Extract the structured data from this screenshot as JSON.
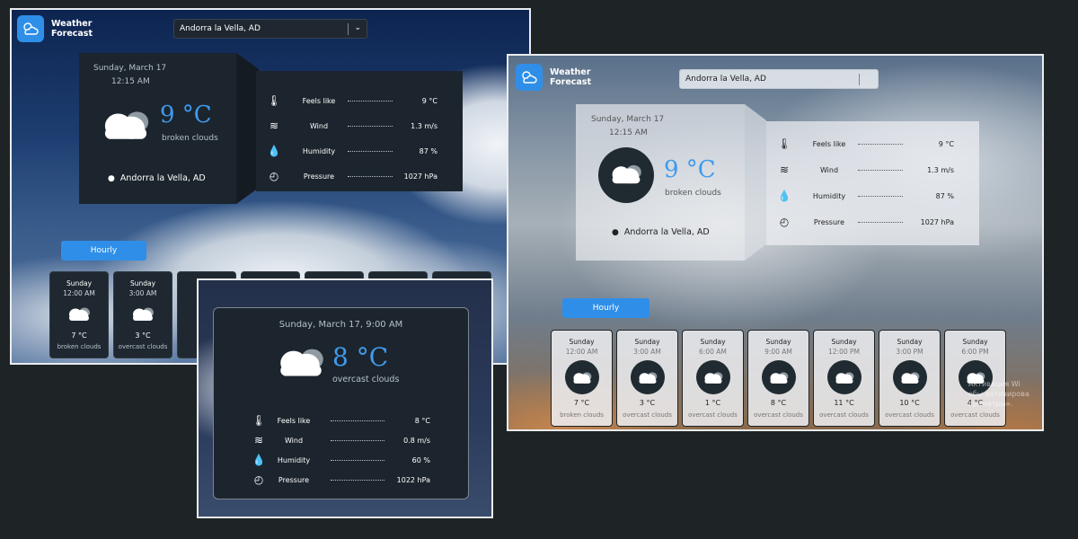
{
  "app": {
    "name_line1": "Weather",
    "name_line2": "Forecast"
  },
  "city_select": {
    "value": "Andorra la Vella, AD"
  },
  "current": {
    "date": "Sunday, March 17",
    "time": "12:15 AM",
    "temp": "9 °C",
    "condition": "broken clouds",
    "location": "Andorra la Vella, AD"
  },
  "details_a": [
    {
      "label": "Feels like",
      "value": "9 °C",
      "icon": "thermometer-icon"
    },
    {
      "label": "Wind",
      "value": "1.3 m/s",
      "icon": "wind-icon"
    },
    {
      "label": "Humidity",
      "value": "87 %",
      "icon": "humidity-icon"
    },
    {
      "label": "Pressure",
      "value": "1027 hPa",
      "icon": "pressure-gauge-icon"
    }
  ],
  "details_b": [
    {
      "label": "Feels like",
      "value": "9 °C"
    },
    {
      "label": "Wind",
      "value": "1.3 m/s"
    },
    {
      "label": "Humidity",
      "value": "87 %"
    },
    {
      "label": "Pressure",
      "value": "1027 hPa"
    }
  ],
  "hourly_label": "Hourly",
  "hourly": [
    {
      "day": "Sunday",
      "time": "12:00 AM",
      "temp": "7 °C",
      "cond": "broken clouds"
    },
    {
      "day": "Sunday",
      "time": "3:00 AM",
      "temp": "3 °C",
      "cond": "overcast clouds"
    },
    {
      "day": "Sunday",
      "time": "6:00 AM",
      "temp": "1 °C",
      "cond": "overcast clouds"
    },
    {
      "day": "Sunday",
      "time": "9:00 AM",
      "temp": "8 °C",
      "cond": "overcast clouds"
    },
    {
      "day": "Sunday",
      "time": "12:00 PM",
      "temp": "11 °C",
      "cond": "overcast clouds"
    },
    {
      "day": "Sunday",
      "time": "3:00 PM",
      "temp": "10 °C",
      "cond": "overcast clouds"
    },
    {
      "day": "Sunday",
      "time": "6:00 PM",
      "temp": "4 °C",
      "cond": "overcast clouds"
    }
  ],
  "modal": {
    "date": "Sunday, March 17, 9:00 AM",
    "temp": "8 °C",
    "condition": "overcast clouds",
    "details": [
      {
        "label": "Feels like",
        "value": "8 °C"
      },
      {
        "label": "Wind",
        "value": "0.8 m/s"
      },
      {
        "label": "Humidity",
        "value": "60 %"
      },
      {
        "label": "Pressure",
        "value": "1022 hPa"
      }
    ]
  },
  "watermark": {
    "line1": "Активация Wi",
    "line2": "обы активирова",
    "line3": "араметры»."
  },
  "colors": {
    "accent": "#3f9af0",
    "button": "#2f8fe8",
    "dark_card": "#1c252d"
  }
}
